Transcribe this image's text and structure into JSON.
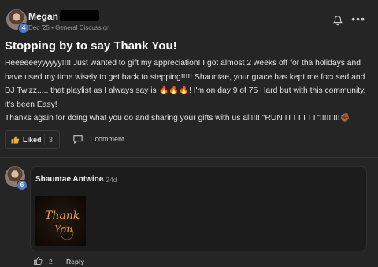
{
  "post": {
    "author": "Megan",
    "level": "4",
    "meta": "Dec '25 • General Discussion",
    "title": "Stopping by to say Thank You!",
    "body_line1": "Heeeeeeyyyyyy!!!! Just wanted to gift my appreciation! I got almost 2 weeks off for tha holidays and have used my time wisely to get back to stepping!!!!! Shauntae, your grace has kept me focused and DJ Twizz..... that playlist as I always say is 🔥🔥🔥! I'm on day 9 of 75 Hard but with this community, it's been Easy!",
    "body_line2": "Thanks again for doing what you do and sharing your gifts with us all!!!! \"RUN ITTTTTT\"!!!!!!!!!✊🏾",
    "like_label": "Liked",
    "like_count": "3",
    "comment_label": "1 comment"
  },
  "comment": {
    "author": "Shauntae Antwine",
    "time": "• 24d",
    "level": "6",
    "image_text_line1": "Thank",
    "image_text_line2": "You",
    "like_count": "2",
    "reply_label": "Reply"
  },
  "colors": {
    "background": "#252525",
    "card": "#1c1c1c",
    "badge": "#4b7bd8",
    "like_icon": "#e8b33a"
  },
  "icons": [
    "bell-icon",
    "more-icon",
    "thumbs-up-icon",
    "comment-bubble-icon"
  ]
}
